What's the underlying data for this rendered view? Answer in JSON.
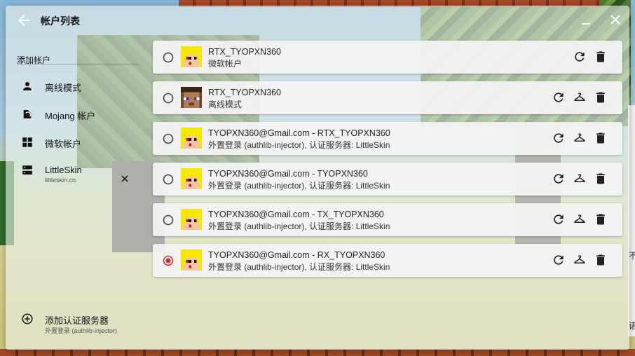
{
  "dialog": {
    "title": "帐户列表"
  },
  "sidebar": {
    "heading": "添加帐户",
    "items": [
      {
        "label": "离线模式",
        "icon": "person-icon"
      },
      {
        "label": "Mojang 帐户",
        "icon": "mojang-icon"
      },
      {
        "label": "微软帐户",
        "icon": "windows-icon"
      },
      {
        "label": "LittleSkin",
        "sub": "littleskin.cn",
        "icon": "server-icon"
      }
    ],
    "add_server": {
      "label": "添加认证服务器",
      "sub": "外置登录 (authlib-injector)",
      "icon": "add-circle-icon"
    }
  },
  "accounts": [
    {
      "name": "RTX_TYOPXN360",
      "type": "微软帐户",
      "selected": false,
      "avatar": "yellow-hair-avatar",
      "actions": [
        "refresh-icon",
        "delete-icon"
      ]
    },
    {
      "name": "RTX_TYOPXN360",
      "type": "离线模式",
      "selected": false,
      "avatar": "steve-avatar",
      "actions": [
        "refresh-icon",
        "hanger-icon",
        "delete-icon"
      ]
    },
    {
      "name": "TYOPXN360@Gmail.com - RTX_TYOPXN360",
      "type": "外置登录 (authlib-injector), 认证服务器: LittleSkin",
      "selected": false,
      "avatar": "yellow-hair-avatar",
      "actions": [
        "refresh-icon",
        "hanger-icon",
        "delete-icon"
      ]
    },
    {
      "name": "TYOPXN360@Gmail.com - TYOPXN360",
      "type": "外置登录 (authlib-injector), 认证服务器: LittleSkin",
      "selected": false,
      "avatar": "yellow-hair-avatar",
      "actions": [
        "refresh-icon",
        "hanger-icon",
        "delete-icon"
      ]
    },
    {
      "name": "TYOPXN360@Gmail.com - TX_TYOPXN360",
      "type": "外置登录 (authlib-injector), 认证服务器: LittleSkin",
      "selected": false,
      "avatar": "yellow-hair-avatar",
      "actions": [
        "refresh-icon",
        "hanger-icon",
        "delete-icon"
      ]
    },
    {
      "name": "TYOPXN360@Gmail.com - RX_TYOPXN360",
      "type": "外置登录 (authlib-injector), 认证服务器: LittleSkin",
      "selected": true,
      "avatar": "yellow-hair-avatar",
      "actions": [
        "refresh-icon",
        "hanger-icon",
        "delete-icon"
      ]
    }
  ],
  "background": {
    "right_text_1": "不",
    "right_text_2": "诺"
  },
  "colors": {
    "accent": "#d32f2f",
    "icon": "#212121"
  }
}
